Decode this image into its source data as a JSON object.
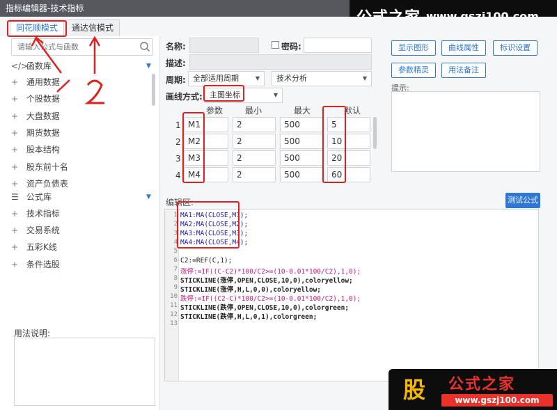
{
  "window": {
    "title": "指标编辑器-技术指标"
  },
  "tabs": [
    {
      "label": "同花顺模式"
    },
    {
      "label": "通达信模式"
    }
  ],
  "search": {
    "placeholder": "请输入公式与函数"
  },
  "sidebar": {
    "func_lib": "函数库",
    "func_items": [
      "通用数据",
      "个股数据",
      "大盘数据",
      "期货数据",
      "股本结构",
      "股东前十名",
      "资产负债表"
    ],
    "formula_lib": "公式库",
    "formula_items": [
      "技术指标",
      "交易系统",
      "五彩K线",
      "条件选股"
    ],
    "usage_label": "用法说明:"
  },
  "form": {
    "name_label": "名称:",
    "password_label": "密码:",
    "desc_label": "描述:",
    "period_label": "周期:",
    "period_value": "全部适用周期",
    "type_value": "技术分析",
    "draw_label": "画线方式:",
    "draw_value": "主图坐标"
  },
  "buttons": {
    "show_graph": "显示图形",
    "curve_props": "曲线属性",
    "mark_settings": "标识设置",
    "param_tuning": "参数精灵",
    "usage_note": "用法备注",
    "test_formula": "测试公式"
  },
  "tip": {
    "label": "提示:"
  },
  "params": {
    "headers": [
      "参数",
      "最小",
      "最大",
      "默认"
    ],
    "rows": [
      {
        "num": "1",
        "name": "M1",
        "min": "2",
        "max": "500",
        "default": "5"
      },
      {
        "num": "2",
        "name": "M2",
        "min": "2",
        "max": "500",
        "default": "10"
      },
      {
        "num": "3",
        "name": "M3",
        "min": "2",
        "max": "500",
        "default": "20"
      },
      {
        "num": "4",
        "name": "M4",
        "min": "2",
        "max": "500",
        "default": "60"
      }
    ]
  },
  "editor": {
    "label": "编辑区:",
    "line_numbers": [
      "1",
      "2",
      "3",
      "4",
      "5",
      "6",
      "7",
      "8",
      "9",
      "10",
      "11",
      "12",
      "13"
    ],
    "lines": [
      "MA1:MA(CLOSE,M1);",
      "MA2:MA(CLOSE,M2);",
      "MA3:MA(CLOSE,M3);",
      "MA4:MA(CLOSE,M4);",
      "",
      "C2:=REF(C,1);",
      "涨停:=IF((C-C2)*100/C2>=(10-0.01*100/C2),1,0);",
      "STICKLINE(涨停,OPEN,CLOSE,10,0),coloryellow;",
      "STICKLINE(涨停,H,L,0,0),coloryellow;",
      "跌停:=IF((C2-C)*100/C2>=(10-0.01*100/C2),1,0);",
      "STICKLINE(跌停,OPEN,CLOSE,10,0),colorgreen;",
      "STICKLINE(跌停,H,L,0,1),colorgreen;",
      ""
    ]
  },
  "annotations": {
    "arrow1": "1",
    "arrow2": "2"
  },
  "watermark": {
    "brand": "公式之家",
    "url": "www.gszj100.com",
    "gu": "股"
  },
  "colors": {
    "accent": "#2d77d6",
    "annotation": "#e02020",
    "titlebar": "#55595e"
  }
}
